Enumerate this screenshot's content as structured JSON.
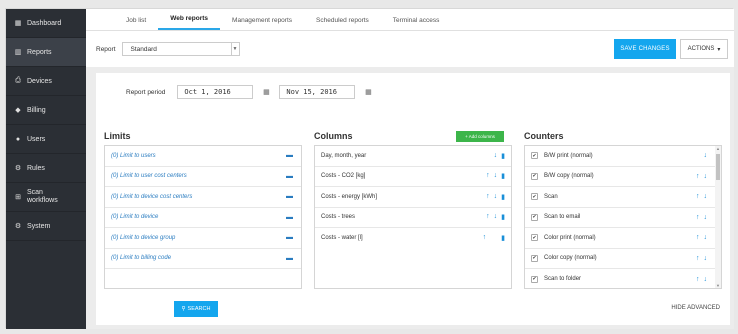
{
  "sidebar": {
    "items": [
      {
        "icon": "dashboard-icon",
        "glyph": "▦",
        "label": "Dashboard",
        "active": false
      },
      {
        "icon": "reports-icon",
        "glyph": "▥",
        "label": "Reports",
        "active": true
      },
      {
        "icon": "printer-icon",
        "glyph": "⎙",
        "label": "Devices",
        "active": false
      },
      {
        "icon": "tag-icon",
        "glyph": "◆",
        "label": "Billing",
        "active": false
      },
      {
        "icon": "user-icon",
        "glyph": "●",
        "label": "Users",
        "active": false
      },
      {
        "icon": "gear-icon",
        "glyph": "⚙",
        "label": "Rules",
        "active": false
      },
      {
        "icon": "sitemap-icon",
        "glyph": "⊞",
        "label": "Scan workflows",
        "active": false
      },
      {
        "icon": "cog-icon",
        "glyph": "⚙",
        "label": "System",
        "active": false
      }
    ]
  },
  "tabs": [
    {
      "label": "Job list",
      "active": false
    },
    {
      "label": "Web reports",
      "active": true
    },
    {
      "label": "Management reports",
      "active": false
    },
    {
      "label": "Scheduled reports",
      "active": false
    },
    {
      "label": "Terminal access",
      "active": false
    }
  ],
  "report": {
    "label": "Report",
    "value": "Standard"
  },
  "buttons": {
    "save": "SAVE CHANGES",
    "actions": "ACTIONS",
    "search": "SEARCH",
    "hide_advanced": "HIDE ADVANCED",
    "add_columns": "+ Add columns"
  },
  "period": {
    "label": "Report period",
    "from": "Oct 1, 2016",
    "to": "Nov 15, 2016"
  },
  "limits": {
    "title": "Limits",
    "items": [
      "(0) Limit to users",
      "(0) Limit to user cost centers",
      "(0) Limit to device cost centers",
      "(0) Limit to device",
      "(0) Limit to device group",
      "(0) Limit to billing code"
    ]
  },
  "columns": {
    "title": "Columns",
    "items": [
      "Day, month, year",
      "Costs - CO2 [kg]",
      "Costs - energy [kWh]",
      "Costs - trees",
      "Costs - water [l]"
    ]
  },
  "counters": {
    "title": "Counters",
    "items": [
      "B/W print (normal)",
      "B/W copy (normal)",
      "Scan",
      "Scan to email",
      "Color print (normal)",
      "Color copy (normal)",
      "Scan to folder"
    ]
  }
}
